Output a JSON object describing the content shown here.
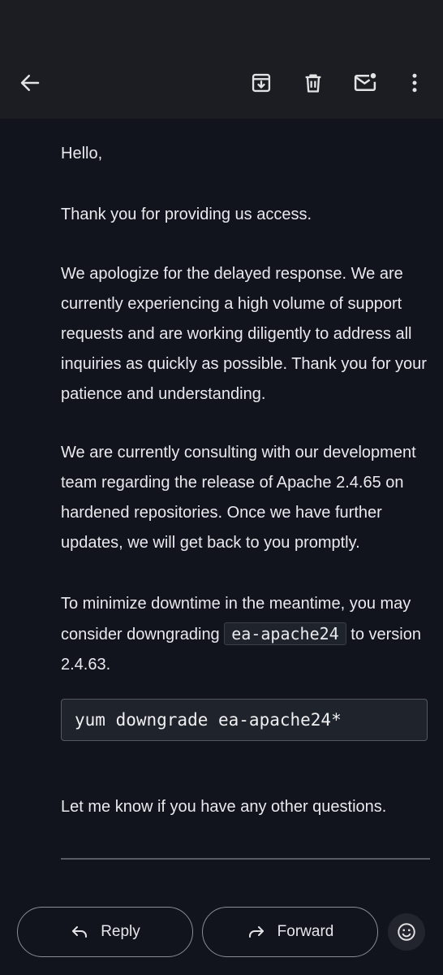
{
  "toolbar": {
    "back_icon": "arrow-left-icon",
    "archive_icon": "archive-icon",
    "delete_icon": "trash-icon",
    "mark_unread_icon": "mail-unread-icon",
    "more_icon": "more-vert-icon"
  },
  "email": {
    "greeting": "Hello,",
    "thanks": "Thank you for providing us access.",
    "apology": "We apologize for the delayed response. We are currently experiencing a high volume of support requests and are working diligently to address all inquiries as quickly as possible. Thank you for your patience and understanding.",
    "consulting": "We are currently consulting with our development team regarding the release of Apache 2.4.65 on hardened repositories. Once we have further updates, we will get back to you promptly.",
    "minimize_before": "To minimize downtime in the meantime, you may consider downgrading",
    "minimize_code": "ea-apache24",
    "minimize_after": "to version 2.4.63.",
    "code_block": "yum downgrade ea-apache24*",
    "closing": "Let me know if you have any other questions."
  },
  "actions": {
    "reply_label": "Reply",
    "forward_label": "Forward",
    "emoji_icon": "smiley-icon"
  }
}
